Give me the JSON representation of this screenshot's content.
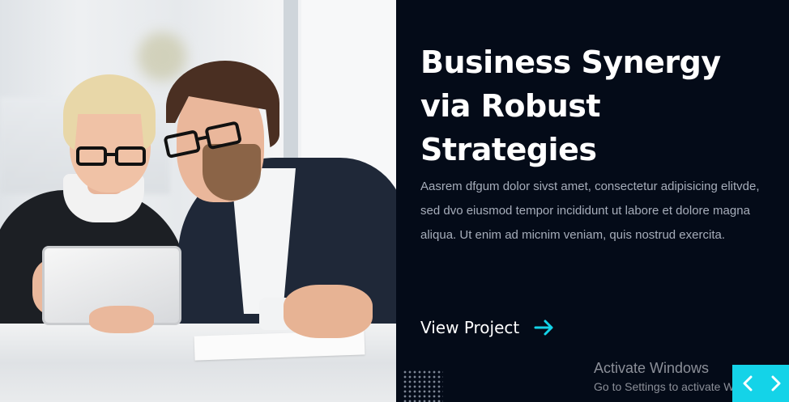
{
  "hero": {
    "title": "Business Synergy via Robust Strategies",
    "description": "Aasrem dfgum dolor sivst amet, consectetur adipisicing elitvde, sed dvo eiusmod tempor incididunt ut labore et dolore magna aliqua. Ut enim ad micnim veniam, quis nostrud exercita.",
    "cta_label": "View Project",
    "accent_color": "#14d3e8",
    "background_color": "#040b18"
  },
  "icons": {
    "cta": "arrow-right-icon",
    "prev": "chevron-left-icon",
    "next": "chevron-right-icon"
  },
  "os_watermark": {
    "line1": "Activate Windows",
    "line2": "Go to Settings to activate Windows."
  }
}
